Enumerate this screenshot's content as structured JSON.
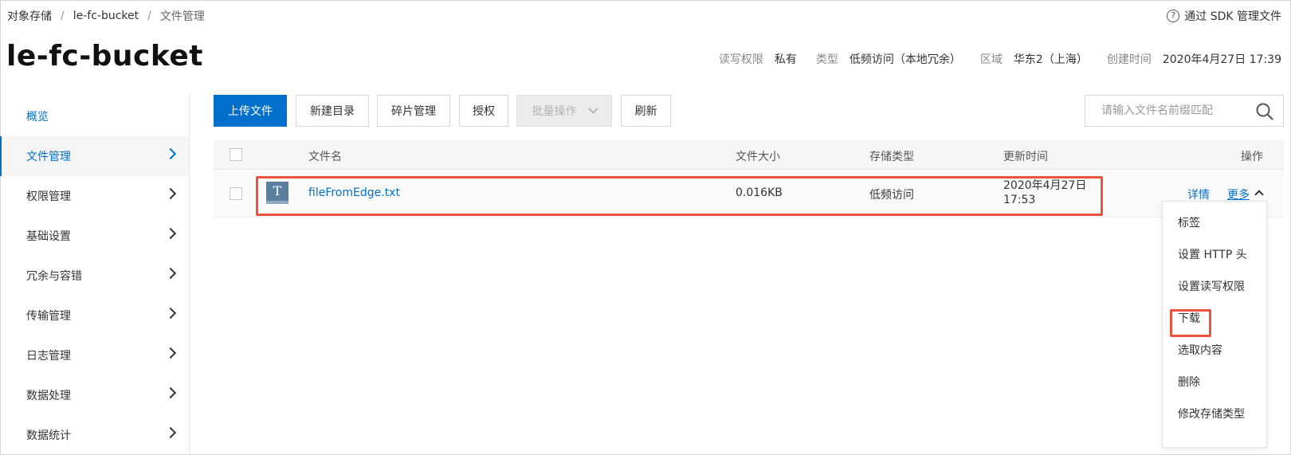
{
  "breadcrumb": {
    "items": [
      "对象存储",
      "le-fc-bucket",
      "文件管理"
    ],
    "separator": "/"
  },
  "sdk_link": {
    "label": "通过 SDK 管理文件",
    "icon": "help-circle-icon"
  },
  "bucket": {
    "title": "le-fc-bucket",
    "meta": [
      {
        "key": "读写权限",
        "value": "私有"
      },
      {
        "key": "类型",
        "value": "低频访问（本地冗余）"
      },
      {
        "key": "区域",
        "value": "华东2（上海）"
      },
      {
        "key": "创建时间",
        "value": "2020年4月27日 17:39"
      }
    ]
  },
  "sidebar": {
    "items": [
      {
        "label": "概览"
      },
      {
        "label": "文件管理"
      },
      {
        "label": "权限管理"
      },
      {
        "label": "基础设置"
      },
      {
        "label": "冗余与容错"
      },
      {
        "label": "传输管理"
      },
      {
        "label": "日志管理"
      },
      {
        "label": "数据处理"
      },
      {
        "label": "数据统计"
      }
    ]
  },
  "toolbar": {
    "upload": "上传文件",
    "new_dir": "新建目录",
    "fragments": "碎片管理",
    "authorize": "授权",
    "batch": "批量操作",
    "refresh": "刷新",
    "search_placeholder": "请输入文件名前缀匹配"
  },
  "table": {
    "headers": {
      "name": "文件名",
      "size": "文件大小",
      "storage": "存储类型",
      "updated": "更新时间",
      "actions": "操作"
    },
    "rows": [
      {
        "icon": "text-file-icon",
        "icon_glyph": "T",
        "name": "fileFromEdge.txt",
        "size": "0.016KB",
        "storage": "低频访问",
        "updated_date": "2020年4月27日",
        "updated_time": "17:53",
        "detail": "详情",
        "more": "更多"
      }
    ]
  },
  "more_menu": {
    "items": [
      "标签",
      "设置 HTTP 头",
      "设置读写权限",
      "下载",
      "选取内容",
      "删除",
      "修改存储类型"
    ]
  },
  "colors": {
    "accent": "#0070cc",
    "highlight": "#e8553c"
  }
}
